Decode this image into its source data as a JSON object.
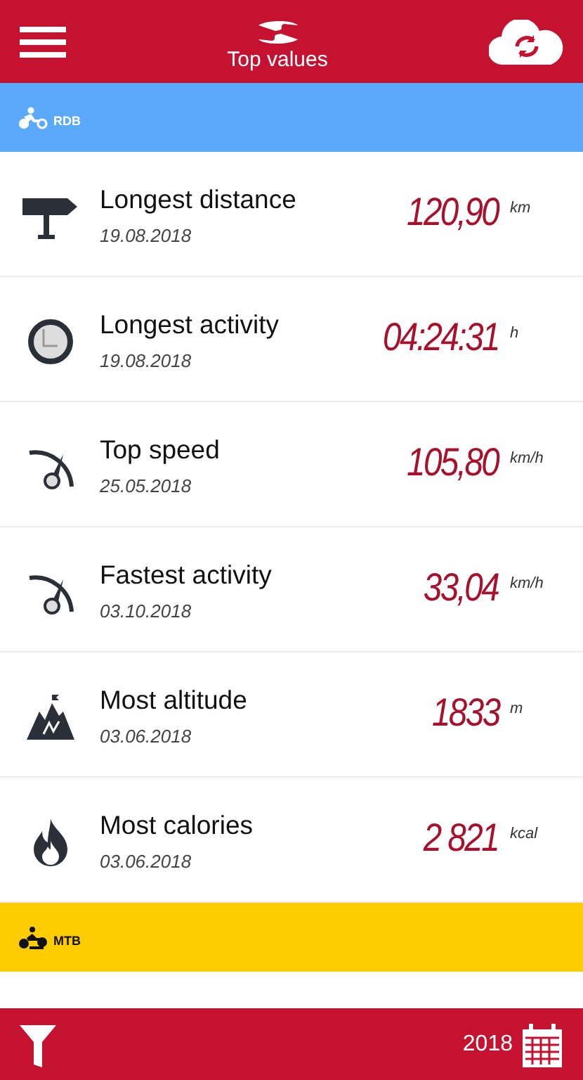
{
  "header": {
    "title": "Top values"
  },
  "sections": [
    {
      "kind": "road",
      "label": "RDB",
      "color": "#5aa9fa",
      "records": [
        {
          "kind": "signpost",
          "title": "Longest distance",
          "date": "19.08.2018",
          "value": "120,90",
          "unit": "km"
        },
        {
          "kind": "clock",
          "title": "Longest activity",
          "date": "19.08.2018",
          "value": "04:24:31",
          "unit": "h"
        },
        {
          "kind": "gauge",
          "title": "Top speed",
          "date": "25.05.2018",
          "value": "105,80",
          "unit": "km/h"
        },
        {
          "kind": "gauge",
          "title": "Fastest activity",
          "date": "03.10.2018",
          "value": "33,04",
          "unit": "km/h"
        },
        {
          "kind": "mountain",
          "title": "Most altitude",
          "date": "03.06.2018",
          "value": "1833",
          "unit": "m"
        },
        {
          "kind": "flame",
          "title": "Most calories",
          "date": "03.06.2018",
          "value": "2 821",
          "unit": "kcal"
        }
      ]
    },
    {
      "kind": "mtb",
      "label": "MTB",
      "color": "#fdcd00"
    }
  ],
  "footer": {
    "year": "2018"
  }
}
